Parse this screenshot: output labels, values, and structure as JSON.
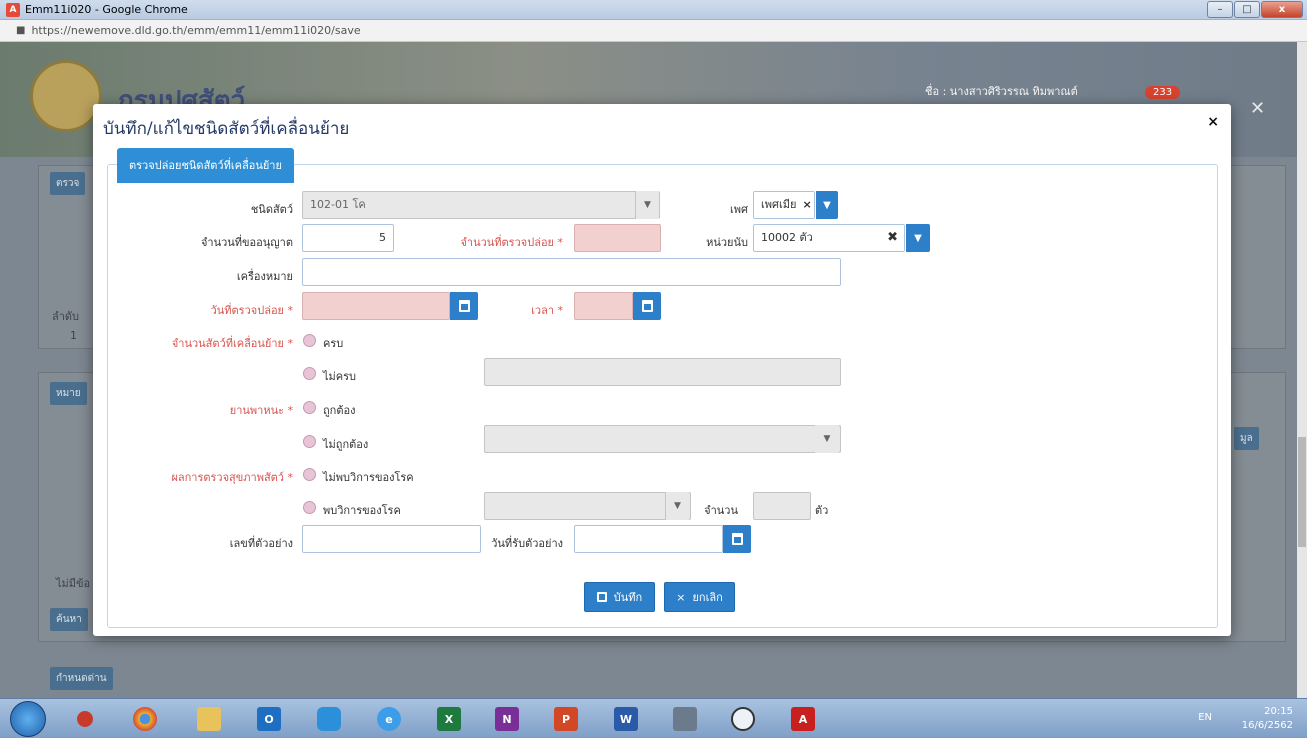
{
  "window": {
    "title": "Emm11i020 - Google Chrome",
    "url": "https://newemove.dld.go.th/emm/emm11/emm11i020/save",
    "minimize": "–",
    "maximize": "□",
    "close": "x"
  },
  "background": {
    "brand": "กรมปศุสัตว์",
    "user": "ชื่อ : นางสาวศิริวรรณ ทิมพาณต์",
    "badge": "233",
    "card1_label": "ตรวจ",
    "col_order": "ลำดับ",
    "row_num": "1",
    "card2_label": "หมาย",
    "no_data": "ไม่มีข้อ",
    "search_btn": "ค้นหา",
    "checkpoint_btn": "กำหนดด่าน",
    "right_btn": "มูล"
  },
  "modal": {
    "title": "บันทึก/แก้ไขชนิดสัตว์ที่เคลื่อนย้าย",
    "close": "×",
    "tab": "ตรวจปล่อยชนิดสัตว์ที่เคลื่อนย้าย"
  },
  "form": {
    "animal_type_label": "ชนิดสัตว์",
    "animal_type_value": "102-01 โค",
    "sex_label": "เพศ",
    "sex_value": "เพศเมีย",
    "requested_qty_label": "จำนวนที่ขออนุญาต",
    "requested_qty_value": "5",
    "released_qty_label": "จำนวนที่ตรวจปล่อย *",
    "unit_label": "หน่วยนับ",
    "unit_value": "10002 ตัว",
    "mark_label": "เครื่องหมาย",
    "release_date_label": "วันที่ตรวจปล่อย *",
    "time_label": "เวลา *",
    "moved_qty_label": "จำนวนสัตว์ที่เคลื่อนย้าย *",
    "complete": "ครบ",
    "incomplete": "ไม่ครบ",
    "vehicle_label": "ยานพาหนะ *",
    "correct": "ถูกต้อง",
    "incorrect": "ไม่ถูกต้อง",
    "health_label": "ผลการตรวจสุขภาพสัตว์ *",
    "no_symptom": "ไม่พบวิการของโรค",
    "symptom": "พบวิการของโรค",
    "count_label": "จำนวน",
    "count_unit": "ตัว",
    "sample_no_label": "เลขที่ตัวอย่าง",
    "sample_date_label": "วันที่รับตัวอย่าง"
  },
  "actions": {
    "save": "บันทึก",
    "cancel": "ยกเลิก"
  },
  "taskbar": {
    "lang": "EN",
    "time": "20:15",
    "date": "16/6/2562",
    "apps": [
      "O",
      "X",
      "N",
      "P",
      "W"
    ]
  }
}
